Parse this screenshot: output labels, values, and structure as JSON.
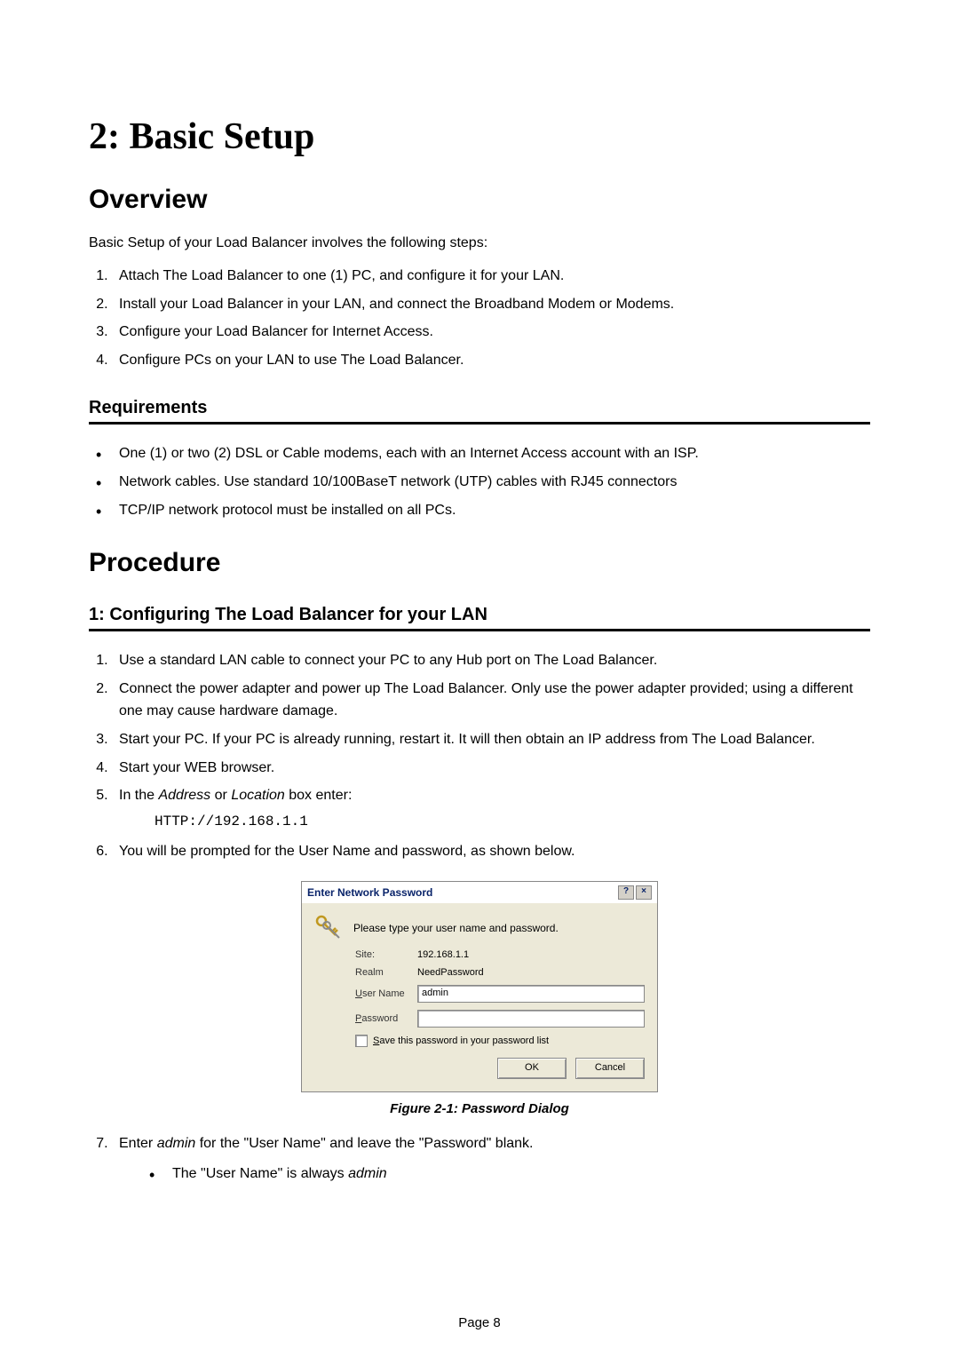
{
  "heading": "2: Basic Setup",
  "section_overview": {
    "title": "Overview",
    "intro": "Basic Setup of your Load Balancer involves the following steps:",
    "steps": [
      "Attach The Load Balancer to one (1) PC, and configure it for your LAN.",
      "Install your Load Balancer in your LAN, and connect the Broadband Modem or Modems.",
      "Configure your Load Balancer for Internet Access.",
      "Configure PCs on your LAN to use The Load Balancer."
    ]
  },
  "requirements": {
    "title": "Requirements",
    "items": [
      "One (1) or two (2) DSL or Cable modems, each with an Internet Access account with an ISP.",
      "Network cables. Use standard 10/100BaseT network (UTP) cables with RJ45 connectors",
      "TCP/IP network protocol must be installed on all PCs."
    ]
  },
  "procedure": {
    "title": "Procedure",
    "config_title": "1: Configuring The Load Balancer for your LAN",
    "step1": "Use a standard LAN cable to connect your PC to any Hub port on The Load Balancer.",
    "step2": "Connect the power adapter and power up The Load Balancer. Only use the power adapter provided; using a different one may cause hardware damage.",
    "step3": "Start your PC. If your PC is already running, restart it. It will then obtain an IP address from The Load Balancer.",
    "step4": "Start your WEB browser.",
    "step5_pre": "In the ",
    "step5_addr": "Address",
    "step5_or": " or ",
    "step5_loc": "Location",
    "step5_post": " box enter:",
    "step5_code": "HTTP://192.168.1.1",
    "step6": "You will be prompted for the User Name and password, as shown below.",
    "step7_pre": "Enter ",
    "step7_admin": "admin",
    "step7_mid": " for the \"User Name\" and leave the \"Password\" blank.",
    "step7_bullet_pre": "The \"User Name\" is always ",
    "step7_bullet_admin": "admin"
  },
  "dialog": {
    "title": "Enter Network Password",
    "prompt": "Please type your user name and password.",
    "site_label": "Site:",
    "site_value": "192.168.1.1",
    "realm_label": "Realm",
    "realm_value": "NeedPassword",
    "user_label_u": "U",
    "user_label_rest": "ser Name",
    "user_value": "admin",
    "pass_label_p": "P",
    "pass_label_rest": "assword",
    "save_s": "S",
    "save_rest": "ave this password in your password list",
    "ok": "OK",
    "cancel": "Cancel",
    "help_btn": "?",
    "close_btn": "×"
  },
  "figure_caption": "Figure 2-1: Password Dialog",
  "page_number": "Page 8"
}
